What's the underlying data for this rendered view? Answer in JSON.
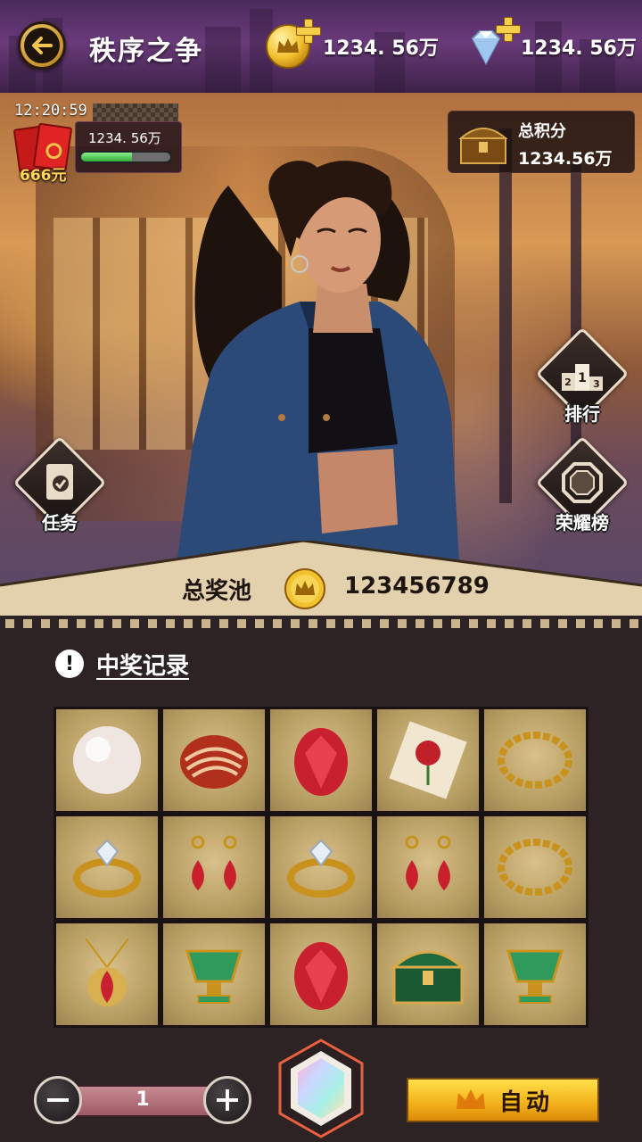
{
  "header": {
    "title": "秩序之争",
    "gold": "1234. 56万",
    "diamonds": "1234. 56万"
  },
  "scene": {
    "timer": "12:20:59",
    "red_packet": {
      "value": "1234. 56万",
      "amount_label": "666元",
      "progress": 0.57
    },
    "score": {
      "label": "总积分",
      "value": "1234.56万"
    },
    "buttons": {
      "tasks": "任务",
      "rank": "排行",
      "honor": "荣耀榜"
    }
  },
  "pool": {
    "label": "总奖池",
    "value": "123456789"
  },
  "records": {
    "title": "中奖记录",
    "items": [
      [
        "pearl",
        "agate",
        "ruby",
        "rose-card",
        "gold-chain"
      ],
      [
        "diamond-ring",
        "ruby-earrings",
        "diamond-ring",
        "ruby-earrings",
        "gold-chain"
      ],
      [
        "ruby-pendant",
        "jade-cup",
        "ruby",
        "treasure-chest",
        "jade-cup"
      ]
    ]
  },
  "controls": {
    "quantity": "1",
    "auto_label": "自动"
  },
  "colors": {
    "accent_gold": "#f2c12e",
    "panel_dark": "#2d2324",
    "cell_tan": "#b39a5e",
    "progress_green": "#2faa3a"
  }
}
